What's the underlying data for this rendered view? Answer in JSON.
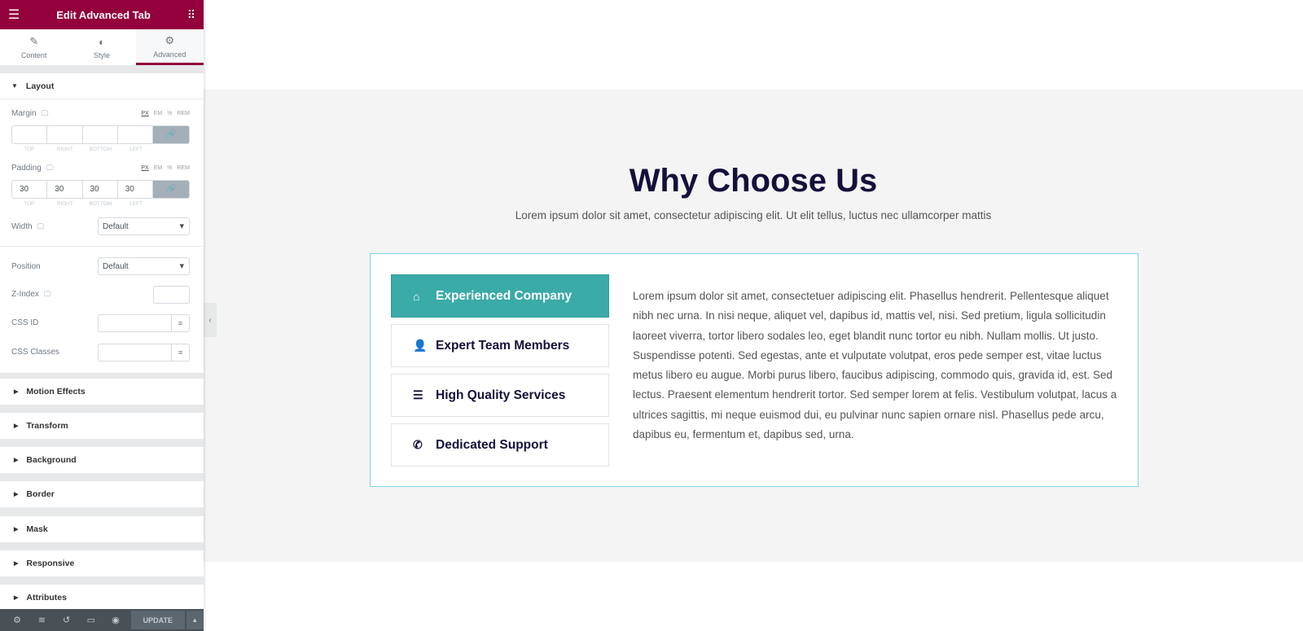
{
  "panel": {
    "title": "Edit Advanced Tab",
    "tabs": [
      {
        "label": "Content",
        "icon": "pencil-icon"
      },
      {
        "label": "Style",
        "icon": "half-circle-icon"
      },
      {
        "label": "Advanced",
        "icon": "gear-icon"
      }
    ],
    "layout": {
      "heading": "Layout",
      "margin": {
        "label": "Margin",
        "units": [
          "PX",
          "EM",
          "%",
          "REM"
        ],
        "values": [
          "",
          "",
          "",
          ""
        ],
        "sides": [
          "TOP",
          "RIGHT",
          "BOTTOM",
          "LEFT"
        ]
      },
      "padding": {
        "label": "Padding",
        "units": [
          "PX",
          "EM",
          "%",
          "REM"
        ],
        "values": [
          "30",
          "30",
          "30",
          "30"
        ],
        "sides": [
          "TOP",
          "RIGHT",
          "BOTTOM",
          "LEFT"
        ]
      },
      "width": {
        "label": "Width",
        "value": "Default"
      },
      "position": {
        "label": "Position",
        "value": "Default"
      },
      "z_index": {
        "label": "Z-Index",
        "value": ""
      },
      "css_id": {
        "label": "CSS ID",
        "value": ""
      },
      "css_classes": {
        "label": "CSS Classes",
        "value": ""
      }
    },
    "sections": [
      "Motion Effects",
      "Transform",
      "Background",
      "Border",
      "Mask",
      "Responsive",
      "Attributes"
    ],
    "footer": {
      "update": "UPDATE"
    }
  },
  "page": {
    "title": "Why Choose Us",
    "subtitle": "Lorem ipsum dolor sit amet, consectetur adipiscing elit. Ut elit tellus, luctus nec ullamcorper mattis",
    "tabs": [
      {
        "label": "Experienced Company",
        "icon": "home-icon",
        "active": true
      },
      {
        "label": "Expert Team Members",
        "icon": "user-icon"
      },
      {
        "label": "High Quality Services",
        "icon": "list-icon"
      },
      {
        "label": "Dedicated Support",
        "icon": "phone-icon"
      }
    ],
    "content": "Lorem ipsum dolor sit amet, consectetuer adipiscing elit. Phasellus hendrerit. Pellentesque aliquet nibh nec urna. In nisi neque, aliquet vel, dapibus id, mattis vel, nisi. Sed pretium, ligula sollicitudin laoreet viverra, tortor libero sodales leo, eget blandit nunc tortor eu nibh. Nullam mollis. Ut justo. Suspendisse potenti. Sed egestas, ante et vulputate volutpat, eros pede semper est, vitae luctus metus libero eu augue. Morbi purus libero, faucibus adipiscing, commodo quis, gravida id, est. Sed lectus. Praesent elementum hendrerit tortor. Sed semper lorem at felis. Vestibulum volutpat, lacus a ultrices sagittis, mi neque euismod dui, eu pulvinar nunc sapien ornare nisl. Phasellus pede arcu, dapibus eu, fermentum et, dapibus sed, urna."
  },
  "colors": {
    "brand": "#93003c",
    "accent": "#3aaba7",
    "heading": "#14103b"
  }
}
